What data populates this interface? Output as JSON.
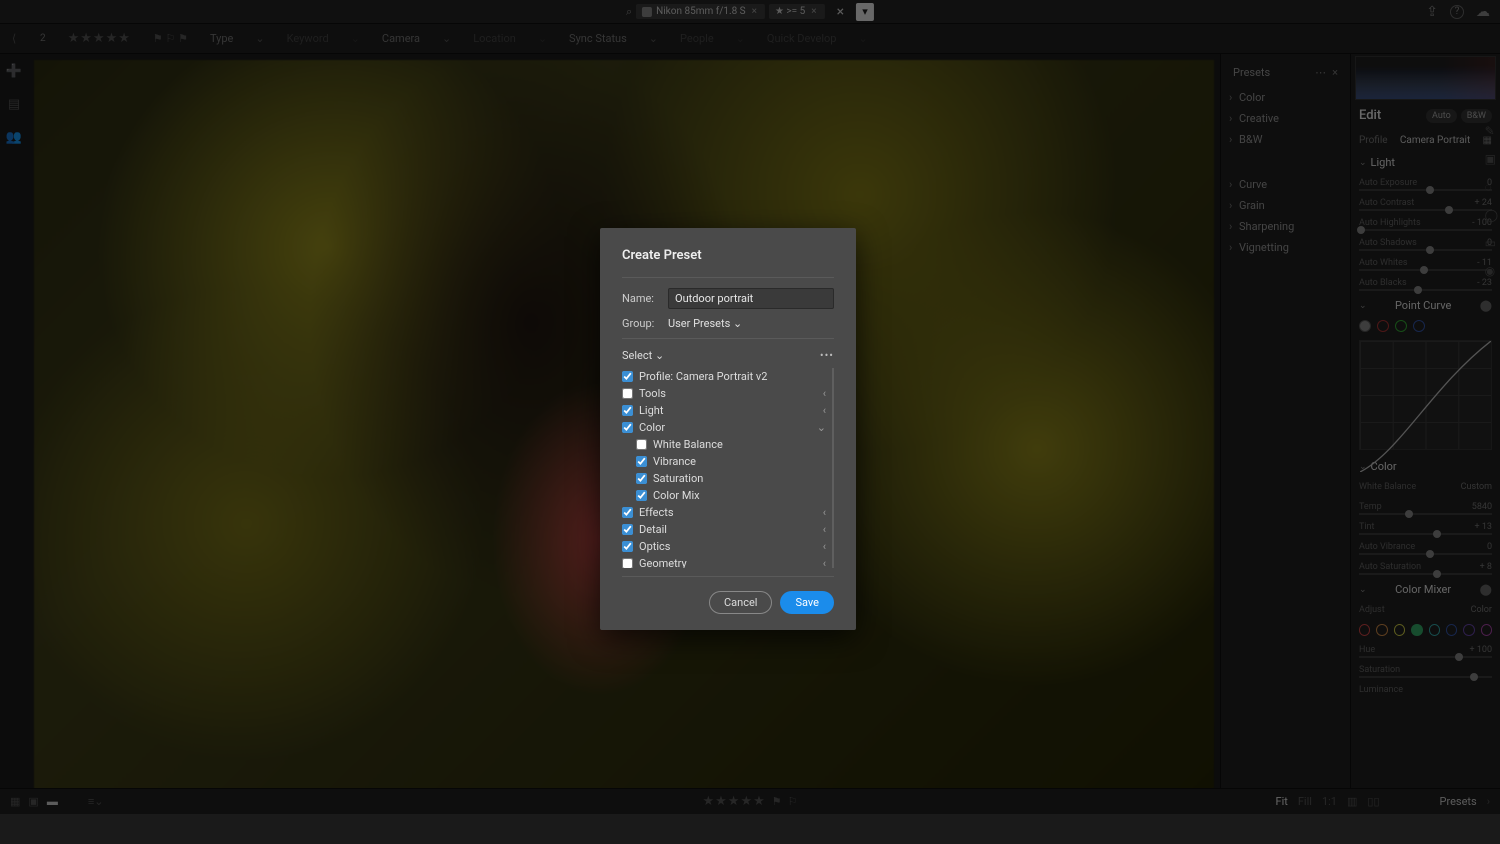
{
  "search": {
    "lens_text": "Nikon 85mm f/1.8 S",
    "rating_text": "★ >= 5"
  },
  "topIcons": {
    "share": "⇪",
    "help": "?",
    "cloud": "☁"
  },
  "filterDrops": [
    "Type",
    "Keyword",
    "Camera",
    "Location",
    "Sync Status",
    "People",
    "Quick Develop"
  ],
  "presets": {
    "header": "Presets",
    "groups": [
      "Color",
      "Creative",
      "B&W",
      "Curve",
      "Grain",
      "Sharpening",
      "Vignetting"
    ]
  },
  "edit": {
    "title": "Edit",
    "auto": "Auto",
    "bw": "B&W",
    "profileLabel": "Profile",
    "profileValue": "Camera Portrait",
    "sections": {
      "light": "Light",
      "pointCurve": "Point Curve",
      "color": "Color",
      "colorMixer": "Color Mixer"
    },
    "sliders": [
      {
        "lbl": "Auto Exposure",
        "val": "0",
        "pos": 50
      },
      {
        "lbl": "Auto Contrast",
        "val": "+ 24",
        "pos": 63
      },
      {
        "lbl": "Auto Highlights",
        "val": "- 100",
        "pos": 4
      },
      {
        "lbl": "Auto Shadows",
        "val": "0",
        "pos": 50
      },
      {
        "lbl": "Auto Whites",
        "val": "- 11",
        "pos": 46
      },
      {
        "lbl": "Auto Blacks",
        "val": "- 23",
        "pos": 42
      }
    ],
    "wb": {
      "label": "White Balance",
      "value": "Custom"
    },
    "colorSliders": [
      {
        "lbl": "Temp",
        "val": "5840",
        "pos": 36
      },
      {
        "lbl": "Tint",
        "val": "+ 13",
        "pos": 55
      },
      {
        "lbl": "Auto Vibrance",
        "val": "0",
        "pos": 50
      },
      {
        "lbl": "Auto Saturation",
        "val": "+ 8",
        "pos": 55
      }
    ],
    "mixer": {
      "adjust": "Adjust",
      "adjustVal": "Color",
      "hue": "Hue",
      "hueVal": "+ 100",
      "sat": "Saturation",
      "satVal": "",
      "lum": "Luminance"
    }
  },
  "bottom": {
    "fit": "Fit",
    "fill": "Fill",
    "oneone": "1:1",
    "presets": "Presets"
  },
  "modal": {
    "title": "Create Preset",
    "nameLabel": "Name:",
    "nameValue": "Outdoor portrait",
    "groupLabel": "Group:",
    "groupValue": "User Presets",
    "select": "Select",
    "items": [
      {
        "label": "Profile: Camera Portrait v2",
        "checked": true,
        "chev": false,
        "child": false
      },
      {
        "label": "Tools",
        "checked": false,
        "chev": true,
        "child": false,
        "collapsed": true
      },
      {
        "label": "Light",
        "checked": true,
        "chev": true,
        "child": false,
        "collapsed": true
      },
      {
        "label": "Color",
        "checked": true,
        "chev": true,
        "child": false,
        "open": true
      },
      {
        "label": "White Balance",
        "checked": false,
        "chev": false,
        "child": true
      },
      {
        "label": "Vibrance",
        "checked": true,
        "chev": false,
        "child": true
      },
      {
        "label": "Saturation",
        "checked": true,
        "chev": false,
        "child": true
      },
      {
        "label": "Color Mix",
        "checked": true,
        "chev": false,
        "child": true
      },
      {
        "label": "Effects",
        "checked": true,
        "chev": true,
        "child": false,
        "collapsed": true
      },
      {
        "label": "Detail",
        "checked": true,
        "chev": true,
        "child": false,
        "collapsed": true
      },
      {
        "label": "Optics",
        "checked": true,
        "chev": true,
        "child": false,
        "collapsed": true
      },
      {
        "label": "Geometry",
        "checked": false,
        "chev": true,
        "child": false,
        "collapsed": true
      }
    ],
    "cancel": "Cancel",
    "save": "Save"
  }
}
